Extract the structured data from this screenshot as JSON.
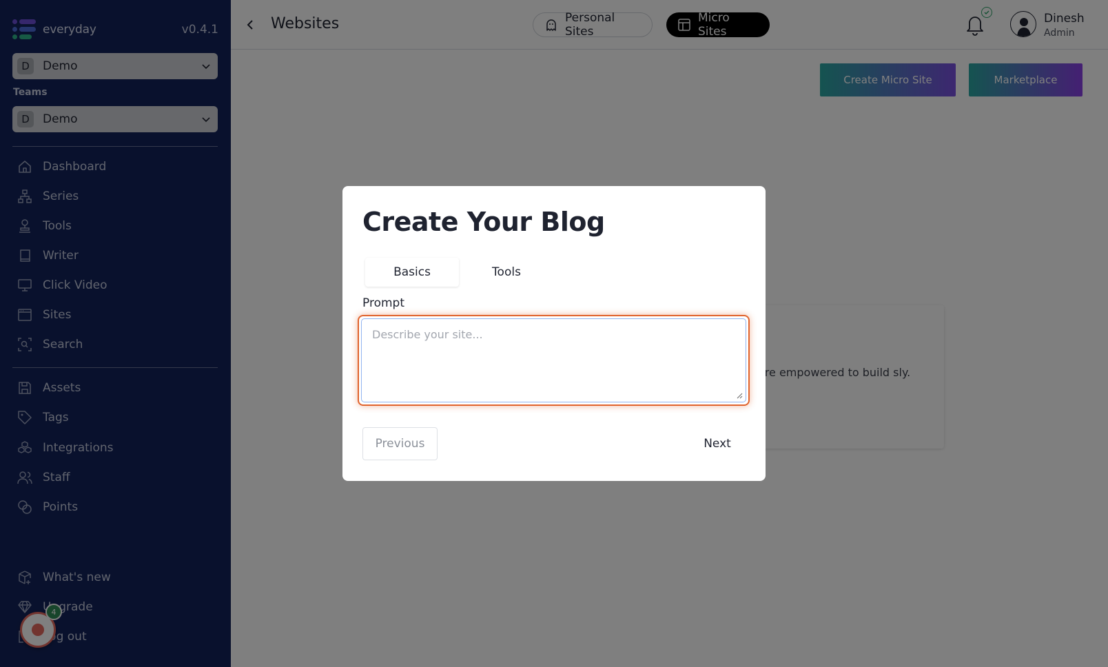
{
  "app": {
    "brand": "everyday",
    "version": "v0.4.1"
  },
  "workspace": {
    "badge": "D",
    "label": "Demo"
  },
  "teams": {
    "heading": "Teams",
    "badge": "D",
    "label": "Demo"
  },
  "nav_primary": [
    {
      "label": "Dashboard",
      "icon": "home-icon"
    },
    {
      "label": "Series",
      "icon": "hierarchy-icon"
    },
    {
      "label": "Tools",
      "icon": "stamp-icon"
    },
    {
      "label": "Writer",
      "icon": "book-icon"
    },
    {
      "label": "Click Video",
      "icon": "monitor-icon"
    },
    {
      "label": "Sites",
      "icon": "browser-window-icon"
    },
    {
      "label": "Search",
      "icon": "scan-search-icon"
    }
  ],
  "nav_secondary": [
    {
      "label": "Assets",
      "icon": "archive-icon"
    },
    {
      "label": "Tags",
      "icon": "tag-icon"
    },
    {
      "label": "Integrations",
      "icon": "cubes-icon"
    },
    {
      "label": "Staff",
      "icon": "users-icon"
    },
    {
      "label": "Points",
      "icon": "coins-icon"
    }
  ],
  "nav_bottom": [
    {
      "label": "What's new",
      "icon": "package-plus-icon"
    },
    {
      "label": "Upgrade",
      "icon": "diamond-icon"
    },
    {
      "label": "Log out",
      "icon": "logout-icon"
    }
  ],
  "chat_widget": {
    "count": "4"
  },
  "header": {
    "title": "Websites",
    "tabs": [
      {
        "label": "Personal Sites",
        "icon": "ghost-icon"
      },
      {
        "label": "Micro Sites",
        "icon": "layout-icon"
      }
    ],
    "user": {
      "name": "Dinesh",
      "role": "Admin"
    }
  },
  "actions": {
    "create": "Create Micro Site",
    "marketplace": "Marketplace"
  },
  "background_card": {
    "text": "are empowered to build sly."
  },
  "modal": {
    "title": "Create Your Blog",
    "tabs": [
      "Basics",
      "Tools"
    ],
    "prompt_label": "Prompt",
    "prompt_placeholder": "Describe your site...",
    "prompt_value": "",
    "previous": "Previous",
    "next": "Next"
  },
  "colors": {
    "sidebar_bg": "#13235a",
    "focus_ring": "#e0632d",
    "gradient_start": "#2aa7a1",
    "gradient_end": "#7a4fe0",
    "notification_ok": "#2fa36b"
  }
}
